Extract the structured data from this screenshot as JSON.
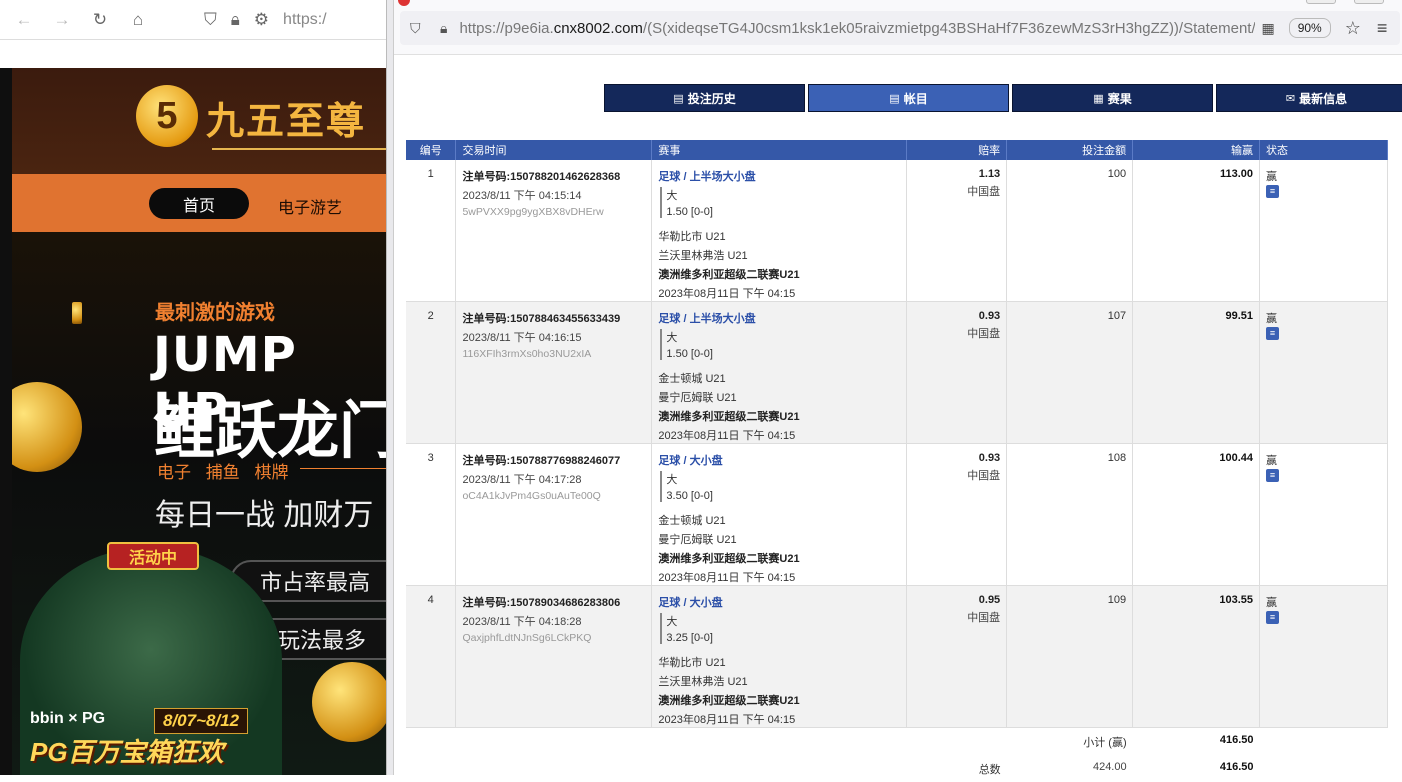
{
  "left_browser": {
    "url_partial": "https:/",
    "site": {
      "logo_mark": "5",
      "logo_text": "九五至尊",
      "nav": {
        "home": "首页",
        "games": "电子游艺"
      },
      "banner": {
        "subtitle": "最刺激的游戏",
        "jump": "JUMP UP",
        "big": "鲤跃龙门",
        "cats": "电子  捕鱼  棋牌",
        "daily": "每日一战  加财万",
        "pill1": "市占率最高",
        "pill2": "玩法最多",
        "active_badge": "活动中",
        "promo_brand": "bbin × PG",
        "promo_date": "8/07~8/12",
        "promo_title": "PG百万宝箱狂欢"
      }
    }
  },
  "right_browser": {
    "url_host": "https://p9e6ia.",
    "url_domain": "cnx8002.com",
    "url_path": "/(S(xideqseTG4J0csm1ksk1ek05raivzmietpg43BSHaHf7F36zewMzS3rH3hgZZ))/Statement/DBe",
    "zoom": "90%"
  },
  "tabs": [
    {
      "label": "投注历史",
      "icon": "receipt-icon"
    },
    {
      "label": "帐目",
      "icon": "ledger-icon"
    },
    {
      "label": "赛果",
      "icon": "results-icon"
    },
    {
      "label": "最新信息",
      "icon": "mail-icon"
    }
  ],
  "table": {
    "headers": {
      "no": "编号",
      "time": "交易时间",
      "event": "赛事",
      "odds": "赔率",
      "stake": "投注金额",
      "win": "输赢",
      "status": "状态"
    },
    "rows": [
      {
        "no": "1",
        "order": "注单号码:150788201462628368",
        "time": "2023/8/11 下午 04:15:14",
        "hash": "5wPVXX9pg9ygXBX8vDHErw",
        "title": "足球 / 上半场大小盘",
        "sel": "大",
        "line": "1.50 [0-0]",
        "team1": "华勒比市 U21",
        "team2": "兰沃里林弗浩 U21",
        "league": "澳洲维多利亚超级二联赛U21",
        "date": "2023年08月11日 下午 04:15",
        "odds": "1.13",
        "market": "中国盘",
        "stake": "100",
        "win": "113.00",
        "status": "赢"
      },
      {
        "no": "2",
        "order": "注单号码:150788463455633439",
        "time": "2023/8/11 下午 04:16:15",
        "hash": "116XFIh3rmXs0ho3NU2xIA",
        "title": "足球 / 上半场大小盘",
        "sel": "大",
        "line": "1.50 [0-0]",
        "team1": "金士顿城 U21",
        "team2": "曼宁厄姆联 U21",
        "league": "澳洲维多利亚超级二联赛U21",
        "date": "2023年08月11日 下午 04:15",
        "odds": "0.93",
        "market": "中国盘",
        "stake": "107",
        "win": "99.51",
        "status": "赢"
      },
      {
        "no": "3",
        "order": "注单号码:150788776988246077",
        "time": "2023/8/11 下午 04:17:28",
        "hash": "oC4A1kJvPm4Gs0uAuTe00Q",
        "title": "足球 / 大小盘",
        "sel": "大",
        "line": "3.50 [0-0]",
        "team1": "金士顿城 U21",
        "team2": "曼宁厄姆联 U21",
        "league": "澳洲维多利亚超级二联赛U21",
        "date": "2023年08月11日 下午 04:15",
        "odds": "0.93",
        "market": "中国盘",
        "stake": "108",
        "win": "100.44",
        "status": "赢"
      },
      {
        "no": "4",
        "order": "注单号码:150789034686283806",
        "time": "2023/8/11 下午 04:18:28",
        "hash": "QaxjphfLdtNJnSg6LCkPKQ",
        "title": "足球 / 大小盘",
        "sel": "大",
        "line": "3.25 [0-0]",
        "team1": "华勒比市 U21",
        "team2": "兰沃里林弗浩 U21",
        "league": "澳洲维多利亚超级二联赛U21",
        "date": "2023年08月11日 下午 04:15",
        "odds": "0.95",
        "market": "中国盘",
        "stake": "109",
        "win": "103.55",
        "status": "赢"
      }
    ],
    "subtotal_label": "小计 (赢)",
    "subtotal_win": "416.50",
    "total_label": "总数",
    "total_stake": "424.00",
    "total_win": "416.50"
  }
}
